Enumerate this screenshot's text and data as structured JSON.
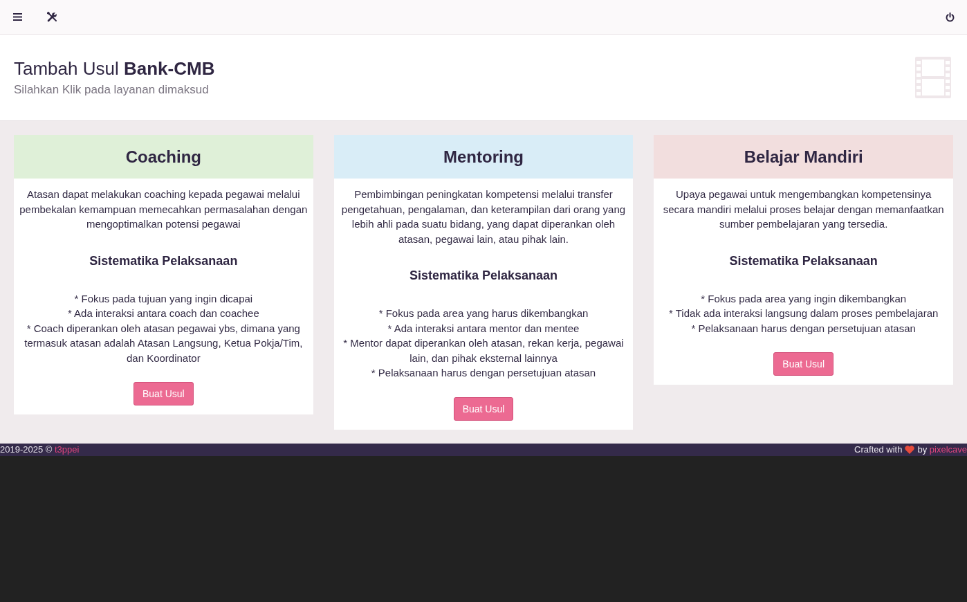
{
  "page_header": {
    "title": "Tambah Usul **Bank-CMB**",
    "subtitle": "Silahkan Klik pada layanan dimaksud"
  },
  "services": [
    {
      "title": "Coaching",
      "color": "#dff0d8",
      "description": "Atasan dapat melakukan coaching kepada pegawai melalui pembekalan kemampuan memecahkan permasalahan dengan mengoptimalkan potensi pegawai",
      "section_heading": "Sistematika Pelaksanaan",
      "points": [
        "* Fokus pada tujuan yang ingin dicapai",
        "* Ada interaksi antara coach dan coachee",
        "* Coach diperankan oleh atasan pegawai ybs, dimana yang termasuk atasan adalah Atasan Langsung, Ketua Pokja/Tim, dan Koordinator"
      ],
      "button": "Buat Usul"
    },
    {
      "title": "Mentoring",
      "color": "#d9edf7",
      "description": "Pembimbingan peningkatan kompetensi melalui transfer pengetahuan, pengalaman, dan keterampilan dari orang yang lebih ahli pada suatu bidang, yang dapat diperankan oleh atasan, pegawai lain, atau pihak lain.",
      "section_heading": "Sistematika Pelaksanaan",
      "points": [
        "* Fokus pada area yang harus dikembangkan",
        "* Ada interaksi antara mentor dan mentee",
        "* Mentor dapat diperankan oleh atasan, rekan kerja, pegawai lain, dan pihak eksternal lainnya",
        "* Pelaksanaan harus dengan persetujuan atasan"
      ],
      "button": "Buat Usul"
    },
    {
      "title": "Belajar Mandiri",
      "color": "#f2dede",
      "description": "Upaya pegawai untuk mengembangkan kompetensinya secara mandiri melalui proses belajar dengan memanfaatkan sumber pembelajaran yang tersedia.",
      "section_heading": "Sistematika Pelaksanaan",
      "points": [
        "* Fokus pada area yang ingin dikembangkan",
        "* Tidak ada interaksi langsung dalam proses pembelajaran",
        "* Pelaksanaan harus dengan persetujuan atasan"
      ],
      "button": "Buat Usul"
    }
  ],
  "footer": {
    "copyright": "2019-2025 ©",
    "copyright_link": "t3ppei",
    "credit_before": "Crafted with",
    "credit_after": "by",
    "credit_link": "pixelcave"
  }
}
